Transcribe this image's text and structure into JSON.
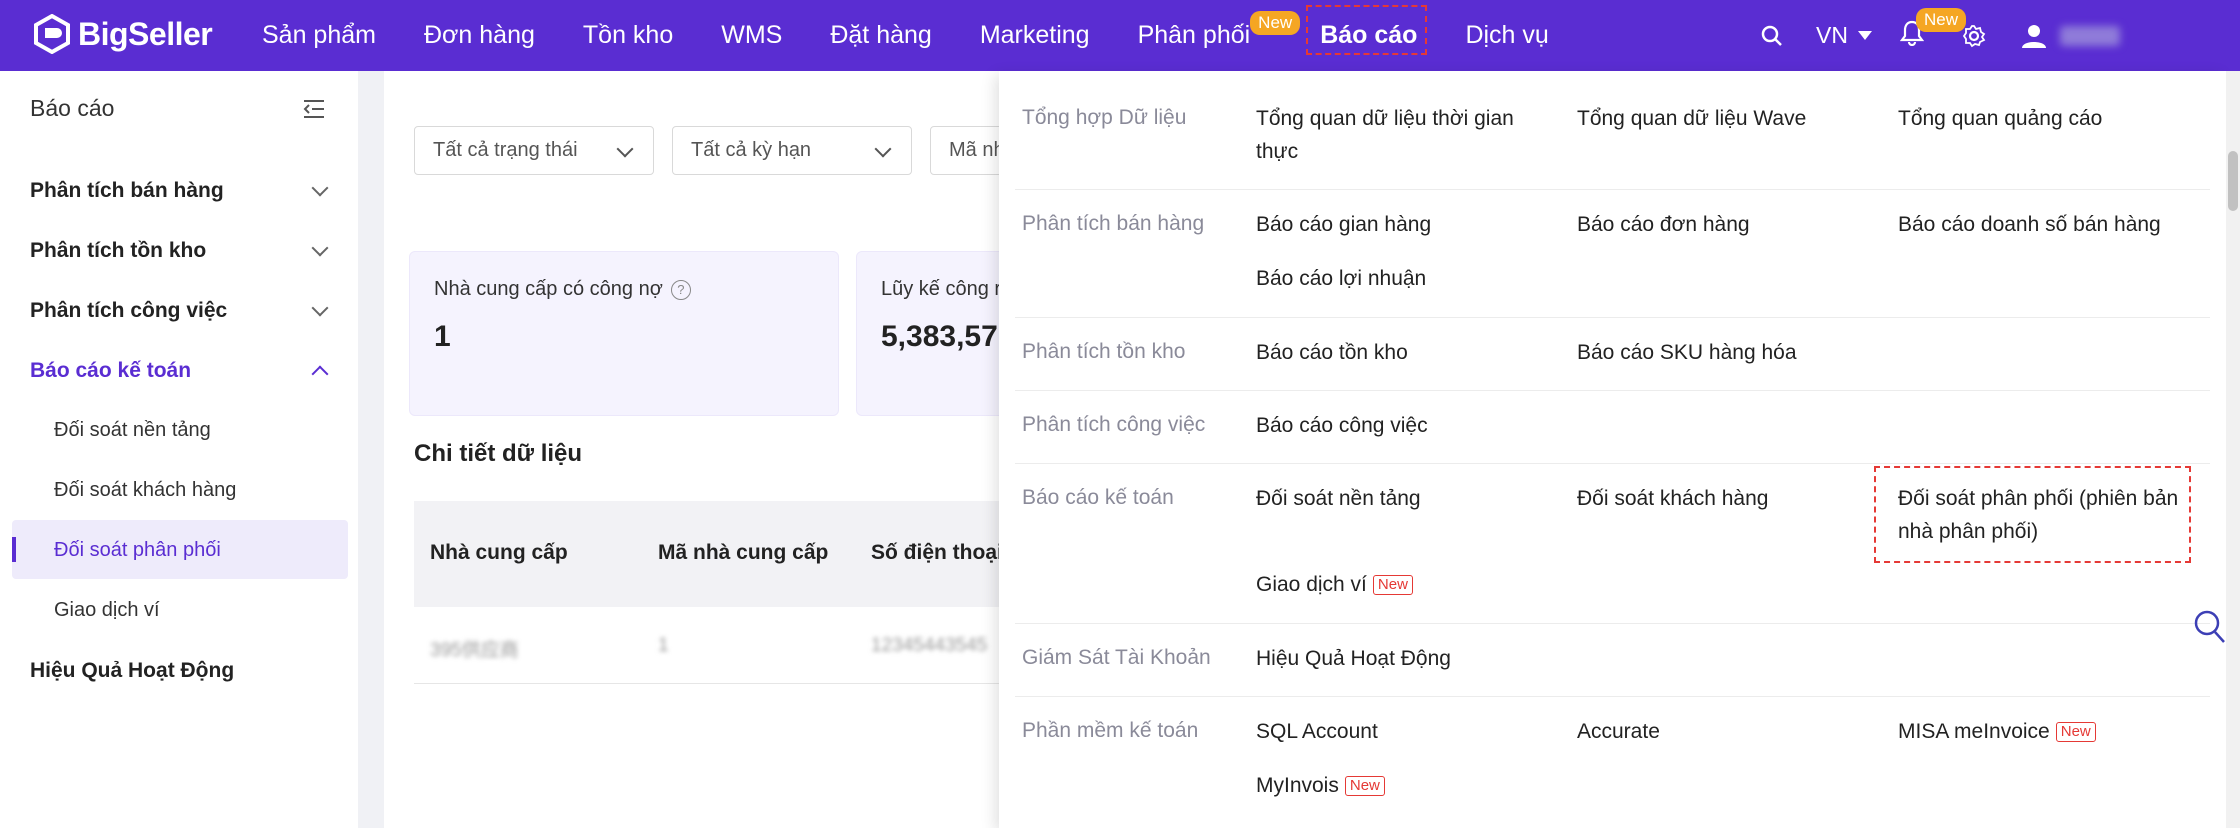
{
  "brand": {
    "name": "BigSeller"
  },
  "nav": {
    "items": [
      "Sản phẩm",
      "Đơn hàng",
      "Tồn kho",
      "WMS",
      "Đặt hàng",
      "Marketing",
      "Phân phối",
      "Báo cáo",
      "Dịch vụ"
    ],
    "distribution_badge": "New",
    "language": "VN",
    "notification_badge": "New"
  },
  "sidebar": {
    "title": "Báo cáo",
    "sales": "Phân tích bán hàng",
    "inventory": "Phân tích tồn kho",
    "work": "Phân tích công việc",
    "accounting": "Báo cáo kế toán",
    "sub": [
      "Đối soát nền tảng",
      "Đối soát khách hàng",
      "Đối soát phân phối",
      "Giao dịch ví"
    ],
    "performance": "Hiệu Quả Hoạt Động"
  },
  "filters": {
    "status": "Tất cả trạng thái",
    "period": "Tất cả kỳ hạn",
    "supplier_code": "Mã nh"
  },
  "cards": {
    "debt_suppliers_label": "Nhà cung cấp có công nợ",
    "debt_suppliers_value": "1",
    "cumulative_label": "Lũy kế công r",
    "cumulative_value": "5,383,57"
  },
  "table": {
    "title": "Chi tiết dữ liệu",
    "headers": [
      "Nhà cung cấp",
      "Mã nhà cung cấp",
      "Số điện thoại"
    ],
    "row": [
      "395供应商",
      "1",
      "12345443545"
    ]
  },
  "mega_menu": {
    "row1": {
      "category": "Tổng hợp Dữ liệu",
      "links": [
        "Tổng quan dữ liệu thời gian thực",
        "Tổng quan dữ liệu Wave",
        "Tổng quan quảng cáo"
      ]
    },
    "row2": {
      "category": "Phân tích bán hàng",
      "links": [
        "Báo cáo gian hàng",
        "Báo cáo đơn hàng",
        "Báo cáo doanh số bán hàng",
        "Báo cáo lợi nhuận"
      ]
    },
    "row3": {
      "category": "Phân tích tồn kho",
      "links": [
        "Báo cáo tồn kho",
        "Báo cáo SKU hàng hóa"
      ]
    },
    "row4": {
      "category": "Phân tích công việc",
      "links": [
        "Báo cáo công việc"
      ]
    },
    "row5": {
      "category": "Báo cáo kế toán",
      "links": [
        "Đối soát nền tảng",
        "Đối soát khách hàng",
        "Đối soát phân phối (phiên bản nhà phân phối)",
        "Giao dịch ví"
      ]
    },
    "row6": {
      "category": "Giám Sát Tài Khoản",
      "links": [
        "Hiệu Quả Hoạt Động"
      ]
    },
    "row7": {
      "category": "Phần mềm kế toán",
      "links": [
        "SQL Account",
        "Accurate",
        "MISA meInvoice",
        "MyInvois"
      ]
    },
    "new_badge": "New"
  }
}
